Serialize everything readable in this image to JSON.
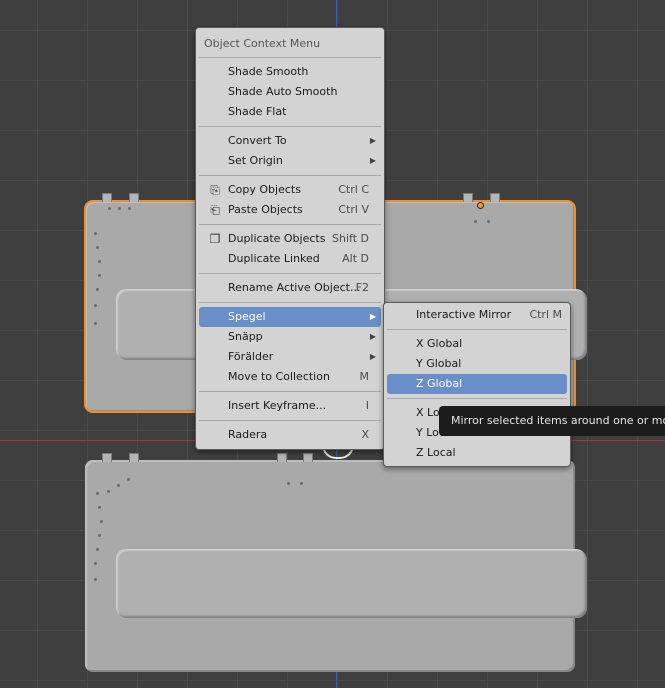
{
  "context_menu": {
    "title": "Object Context Menu",
    "items": [
      {
        "label": "Shade Smooth",
        "shortcut": ""
      },
      {
        "label": "Shade Auto Smooth",
        "shortcut": ""
      },
      {
        "label": "Shade Flat",
        "shortcut": ""
      },
      {
        "label": "Convert To",
        "shortcut": ""
      },
      {
        "label": "Set Origin",
        "shortcut": ""
      },
      {
        "label": "Copy Objects",
        "shortcut": "Ctrl C",
        "icon": "copy-icon"
      },
      {
        "label": "Paste Objects",
        "shortcut": "Ctrl V",
        "icon": "paste-icon"
      },
      {
        "label": "Duplicate Objects",
        "shortcut": "Shift D",
        "icon": "duplicate-icon"
      },
      {
        "label": "Duplicate Linked",
        "shortcut": "Alt D"
      },
      {
        "label": "Rename Active Object...",
        "shortcut": "F2"
      },
      {
        "label": "Spegel",
        "shortcut": ""
      },
      {
        "label": "Snäpp",
        "shortcut": ""
      },
      {
        "label": "Förälder",
        "shortcut": ""
      },
      {
        "label": "Move to Collection",
        "shortcut": "M"
      },
      {
        "label": "Insert Keyframe...",
        "shortcut": "I"
      },
      {
        "label": "Radera",
        "shortcut": "X"
      }
    ]
  },
  "mirror_submenu": {
    "items": [
      {
        "label": "Interactive Mirror",
        "shortcut": "Ctrl M"
      },
      {
        "label": "X Global",
        "shortcut": ""
      },
      {
        "label": "Y Global",
        "shortcut": ""
      },
      {
        "label": "Z Global",
        "shortcut": ""
      },
      {
        "label": "X Local",
        "shortcut": ""
      },
      {
        "label": "Y Local",
        "shortcut": ""
      },
      {
        "label": "Z Local",
        "shortcut": ""
      }
    ]
  },
  "tooltip": {
    "text": "Mirror selected items around one or more a"
  },
  "colors": {
    "highlight": "#6a8ec8",
    "selection_outline": "#f0902a",
    "menu_bg": "#d3d3d3"
  }
}
